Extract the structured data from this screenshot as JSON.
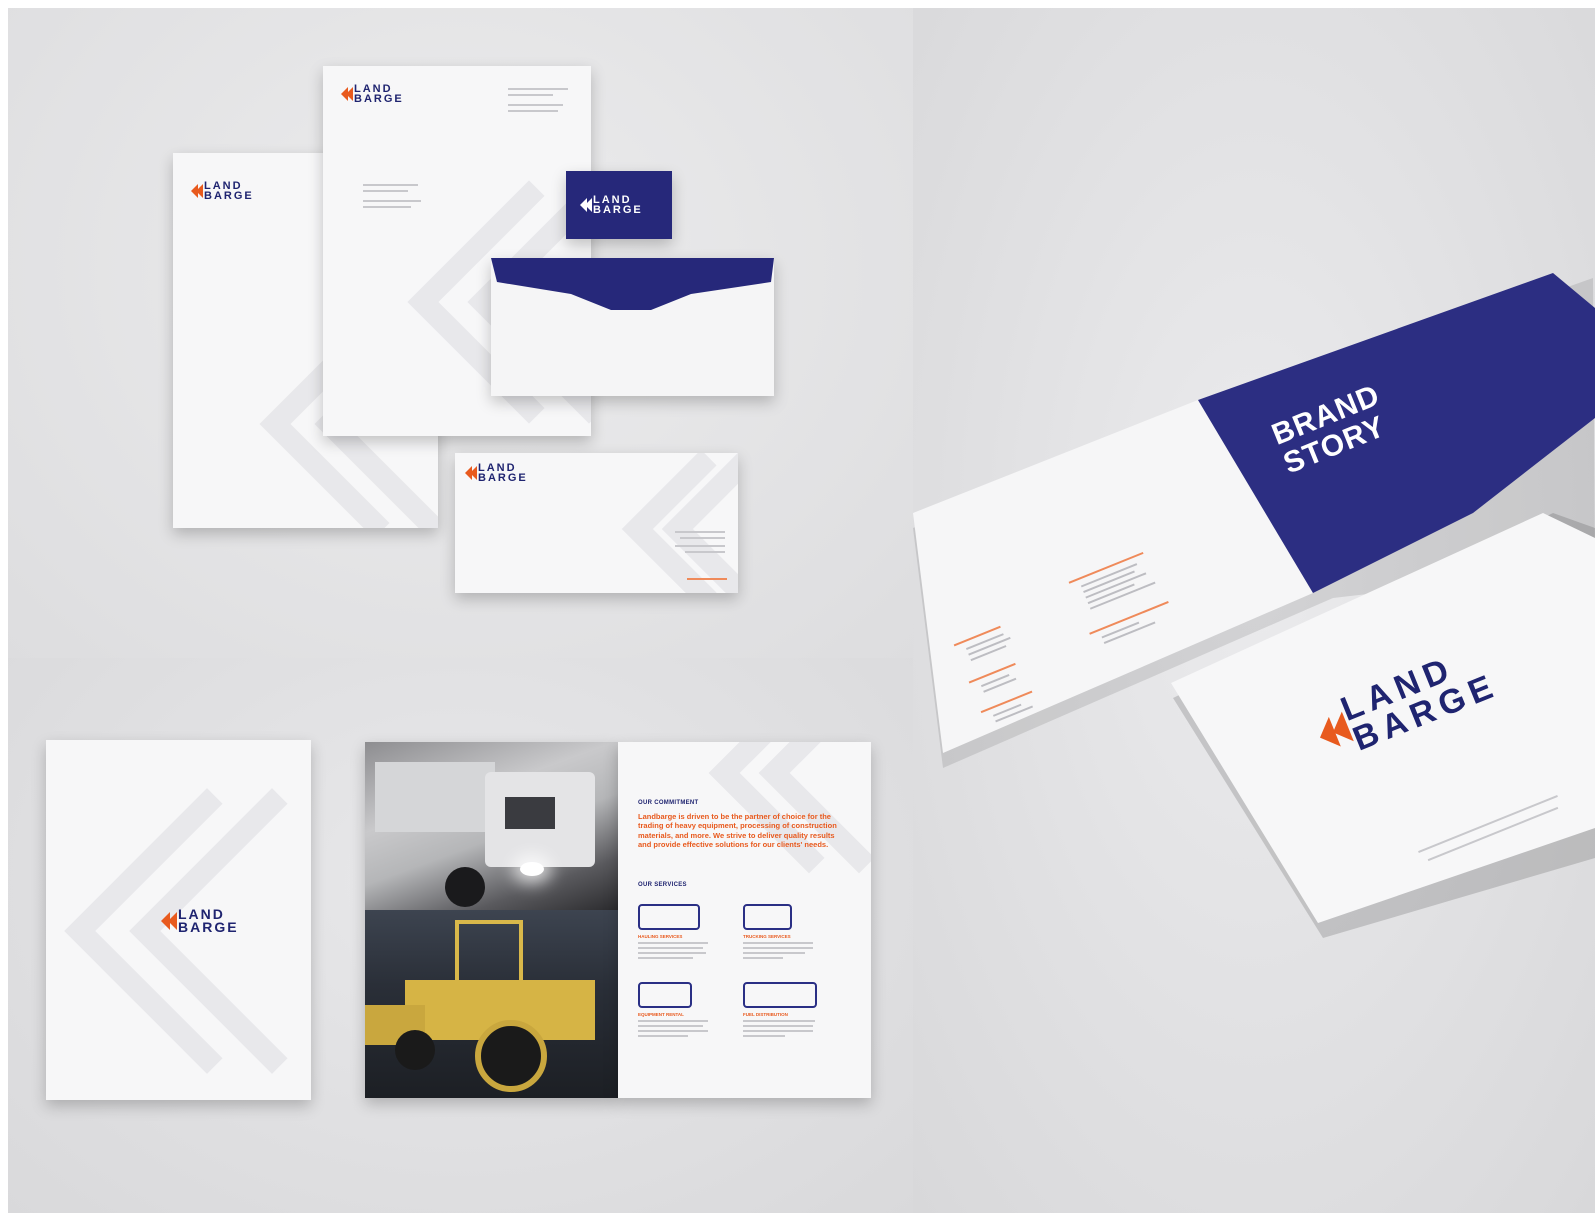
{
  "brand": {
    "mark_word1": "LAND",
    "mark_word2": "BARGE",
    "colors": {
      "navy": "#26287a",
      "orange": "#e85a1e",
      "paper": "#f7f7f8"
    }
  },
  "brochure": {
    "commitment_heading": "OUR COMMITMENT",
    "commitment_text": "Landbarge is driven to be the partner of choice for the trading of heavy equipment, processing of construction materials, and more. We strive to deliver quality results and provide effective solutions for our clients' needs.",
    "services_heading": "OUR SERVICES",
    "services": [
      {
        "icon": "dump-truck-icon",
        "title": "HAULING SERVICES"
      },
      {
        "icon": "delivery-truck-icon",
        "title": "TRUCKING SERVICES"
      },
      {
        "icon": "cement-mixer-icon",
        "title": "EQUIPMENT RENTAL"
      },
      {
        "icon": "fuel-tanker-icon",
        "title": "FUEL DISTRIBUTION"
      }
    ]
  },
  "brand_book": {
    "cover_title_line1": "BRAND",
    "cover_title_line2": "STORY"
  }
}
